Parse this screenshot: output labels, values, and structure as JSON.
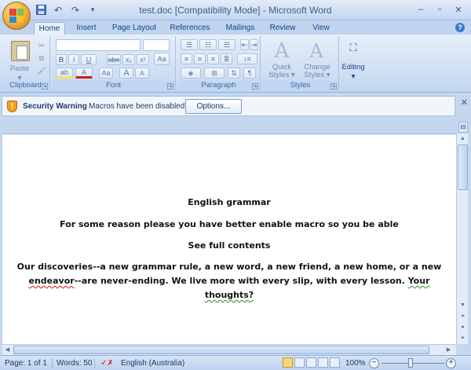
{
  "window": {
    "title": "test.doc [Compatibility Mode] - Microsoft Word",
    "minimize": "–",
    "maximize": "▫",
    "close": "✕"
  },
  "qat": {
    "save": "💾",
    "undo": "↶",
    "redo": "↷",
    "customize": "▾"
  },
  "tabs": [
    "Home",
    "Insert",
    "Page Layout",
    "References",
    "Mailings",
    "Review",
    "View"
  ],
  "help": "?",
  "ribbon": {
    "clipboard": {
      "label": "Clipboard",
      "paste": "Paste"
    },
    "font": {
      "label": "Font",
      "bold": "B",
      "italic": "I",
      "underline": "U",
      "strike": "abe",
      "sub": "x₂",
      "sup": "x²",
      "clear": "Aa",
      "color": "A",
      "grow": "A",
      "shrink": "A"
    },
    "paragraph": {
      "label": "Paragraph",
      "show": "¶"
    },
    "styles": {
      "label": "Styles",
      "quick": "Quick\nStyles",
      "quick_l1": "Quick",
      "quick_l2": "Styles ▾",
      "change_l1": "Change",
      "change_l2": "Styles ▾"
    },
    "editing": {
      "label": "Editing",
      "arrow": "▾"
    }
  },
  "security": {
    "title": "Security Warning",
    "message": "Macros have been disabled.",
    "options": "Options..."
  },
  "document": {
    "heading": "English grammar",
    "line1": "For some reason please you have better enable macro so you be able",
    "line2": "See full contents",
    "para_a": "Our discoveries--a new grammar rule, a new word, a new friend, a new home, or a new",
    "para_b1": "endeavor",
    "para_b2": "--are never-ending. We live more with every slip, with every lesson. ",
    "para_b3": "Your",
    "para_c": "thoughts?"
  },
  "status": {
    "page": "Page: 1 of 1",
    "words": "Words: 50",
    "language": "English (Australia)",
    "zoom": "100%"
  },
  "colors": {
    "accent": "#15428b",
    "ribbon_bg": "#d2e0f3",
    "warning": "#f3a01f"
  }
}
